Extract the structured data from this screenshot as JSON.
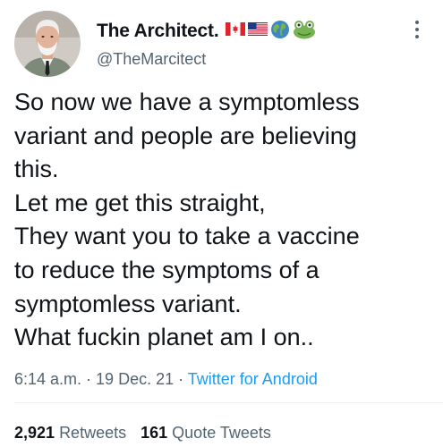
{
  "author": {
    "display_name": "The Architect.",
    "handle": "@TheMarcitect",
    "flag_icons": [
      "flag-canada-icon",
      "flag-usa-icon",
      "globe-icon",
      "frog-icon"
    ]
  },
  "tweet": {
    "lines": [
      "So now we have a symptomless",
      "variant and people are believing",
      "this.",
      "Let me get this straight,",
      "They want you to take a vaccine",
      "to reduce the symptoms of a",
      "symptomless variant.",
      "What fuckin planet am I on.."
    ]
  },
  "meta": {
    "time": "6:14 a.m.",
    "sep1": " · ",
    "date": "19 Dec. 21",
    "sep2": " · ",
    "source": "Twitter for Android"
  },
  "stats": {
    "retweets_count": "2,921",
    "retweets_label": "Retweets",
    "quotes_count": "161",
    "quotes_label": "Quote Tweets"
  },
  "colors": {
    "text": "#0f1419",
    "secondary": "#536471",
    "link": "#1d9bf0"
  }
}
